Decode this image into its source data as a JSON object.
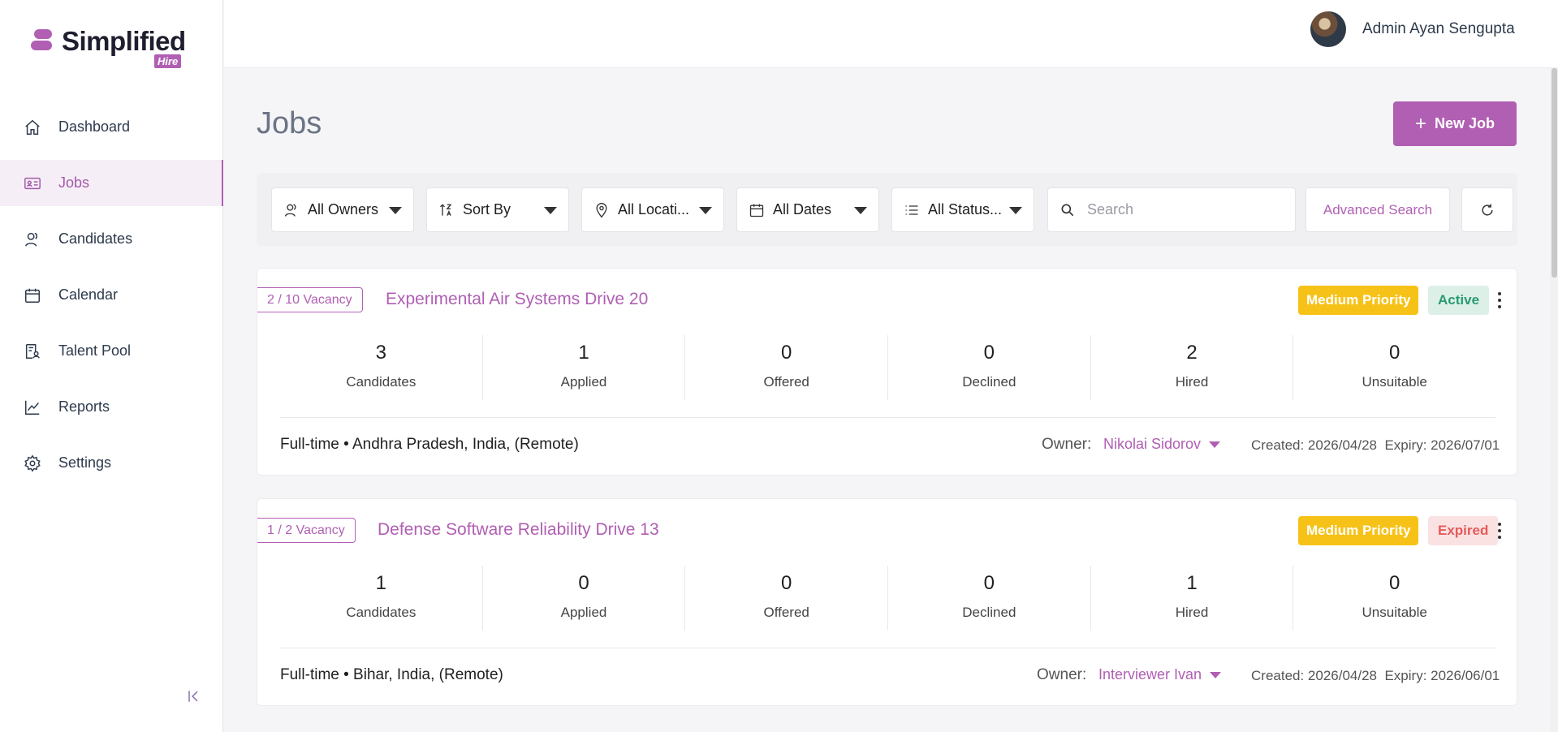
{
  "brand": {
    "name": "Simplified",
    "badge": "Hire"
  },
  "user": {
    "name": "Admin Ayan Sengupta"
  },
  "sidebar": {
    "items": [
      {
        "label": "Dashboard",
        "icon": "home-icon"
      },
      {
        "label": "Jobs",
        "icon": "id-card-icon",
        "active": true
      },
      {
        "label": "Candidates",
        "icon": "people-icon"
      },
      {
        "label": "Calendar",
        "icon": "calendar-icon"
      },
      {
        "label": "Talent Pool",
        "icon": "document-person-icon"
      },
      {
        "label": "Reports",
        "icon": "line-chart-icon"
      },
      {
        "label": "Settings",
        "icon": "gear-icon"
      }
    ]
  },
  "page": {
    "title": "Jobs",
    "new_job_label": "New Job"
  },
  "filters": {
    "owners": "All Owners",
    "sort": "Sort By",
    "locations": "All Locati...",
    "dates": "All Dates",
    "status": "All Status...",
    "search_placeholder": "Search",
    "advanced_search": "Advanced Search"
  },
  "jobs": [
    {
      "vacancy": "2 / 10 Vacancy",
      "title": "Experimental Air Systems Drive 20",
      "priority": "Medium Priority",
      "status": "Active",
      "stats": [
        {
          "value": "3",
          "label": "Candidates"
        },
        {
          "value": "1",
          "label": "Applied"
        },
        {
          "value": "0",
          "label": "Offered"
        },
        {
          "value": "0",
          "label": "Declined"
        },
        {
          "value": "2",
          "label": "Hired"
        },
        {
          "value": "0",
          "label": "Unsuitable"
        }
      ],
      "meta": "Full-time • Andhra Pradesh, India, (Remote)",
      "owner_label": "Owner:",
      "owner": "Nikolai Sidorov",
      "created": "Created: 2026/04/28",
      "expiry": "Expiry: 2026/07/01"
    },
    {
      "vacancy": "1 / 2 Vacancy",
      "title": "Defense Software Reliability Drive 13",
      "priority": "Medium Priority",
      "status": "Expired",
      "stats": [
        {
          "value": "1",
          "label": "Candidates"
        },
        {
          "value": "0",
          "label": "Applied"
        },
        {
          "value": "0",
          "label": "Offered"
        },
        {
          "value": "0",
          "label": "Declined"
        },
        {
          "value": "1",
          "label": "Hired"
        },
        {
          "value": "0",
          "label": "Unsuitable"
        }
      ],
      "meta": "Full-time • Bihar, India, (Remote)",
      "owner_label": "Owner:",
      "owner": "Interviewer Ivan",
      "created": "Created: 2026/04/28",
      "expiry": "Expiry: 2026/06/01"
    }
  ],
  "colors": {
    "accent": "#b05fb3",
    "priority": "#f7c217",
    "active": "#2a9a72",
    "expired": "#e55b5b"
  }
}
